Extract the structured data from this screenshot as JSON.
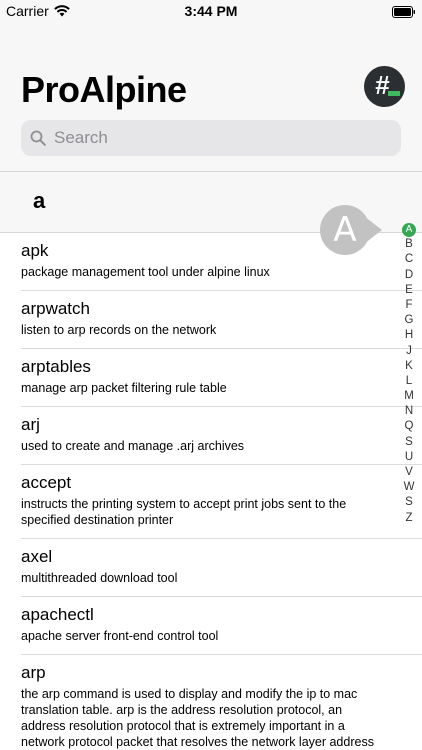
{
  "status_bar": {
    "carrier": "Carrier",
    "time": "3:44 PM",
    "icons": [
      "wifi-icon",
      "battery-icon"
    ]
  },
  "header": {
    "title": "ProAlpine",
    "hash_button_icon": "hash-terminal-icon",
    "hash_symbol": "#"
  },
  "search": {
    "placeholder": "Search",
    "icon": "search-icon"
  },
  "section": {
    "letter": "a"
  },
  "commands": [
    {
      "name": "apk",
      "description": "package management tool under alpine linux"
    },
    {
      "name": "arpwatch",
      "description": "listen to arp records on the network"
    },
    {
      "name": "arptables",
      "description": "manage arp packet filtering rule table"
    },
    {
      "name": "arj",
      "description": "used to create and manage .arj archives"
    },
    {
      "name": "accept",
      "description": "instructs the printing system to accept print jobs sent to the specified destination printer"
    },
    {
      "name": "axel",
      "description": "multithreaded download tool"
    },
    {
      "name": "apachectl",
      "description": "apache server front-end control tool"
    },
    {
      "name": "arp",
      "description": "the arp command is used to display and modify the ip to mac translation table. arp is the address resolution protocol, an address resolution protocol that is extremely important in a network protocol packet that resolves the network layer address"
    }
  ],
  "index": {
    "letters": [
      "A",
      "B",
      "C",
      "D",
      "E",
      "F",
      "G",
      "H",
      "J",
      "K",
      "L",
      "M",
      "N",
      "Q",
      "S",
      "U",
      "V",
      "W",
      "S",
      "Z"
    ],
    "active": "A",
    "active_color": "#34a853"
  },
  "bubble": {
    "letter": "A"
  },
  "colors": {
    "header_bg": "#f7f7f7",
    "accent": "#34a853",
    "search_bg": "#e6e6e8"
  }
}
